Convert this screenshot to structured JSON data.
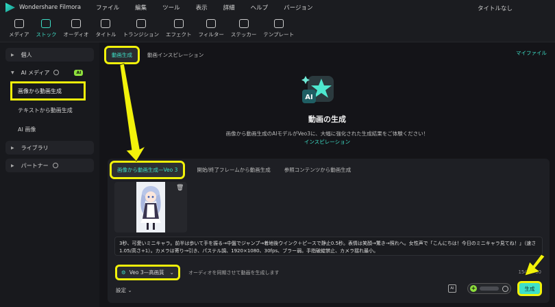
{
  "titlebar": {
    "app_name": "Wondershare Filmora",
    "menu": [
      "ファイル",
      "編集",
      "ツール",
      "表示",
      "詳細",
      "ヘルプ",
      "バージョン"
    ],
    "document_title": "タイトルなし"
  },
  "toolbar": {
    "items": [
      {
        "label": "メディア",
        "icon": "media-icon"
      },
      {
        "label": "ストック",
        "icon": "stock-icon"
      },
      {
        "label": "オーディオ",
        "icon": "audio-icon"
      },
      {
        "label": "タイトル",
        "icon": "title-icon"
      },
      {
        "label": "トランジション",
        "icon": "transition-icon"
      },
      {
        "label": "エフェクト",
        "icon": "effect-icon"
      },
      {
        "label": "フィルター",
        "icon": "filter-icon"
      },
      {
        "label": "ステッカー",
        "icon": "sticker-icon"
      },
      {
        "label": "テンプレート",
        "icon": "template-icon"
      }
    ],
    "active_index": 1
  },
  "sidebar": {
    "personal": "個人",
    "ai_media": "AI メディア",
    "ai_badge": "AI",
    "sub_items": [
      "画像から動画生成",
      "テキストから動画生成",
      "AI 画像"
    ],
    "library": "ライブラリ",
    "partner": "パートナー"
  },
  "main": {
    "tab_active": "動画生成",
    "tab_inspiration": "動画インスピレーション",
    "my_files": "マイファイル",
    "hero_title": "動画の生成",
    "hero_desc": "画像から動画生成のAIモデルがVeo3に、大幅に強化された生成結果をご体験ください！",
    "hero_link": "インスピレーション",
    "gen_tabs": [
      "画像から動画生成—Veo 3",
      "開始/終了フレームから動画生成",
      "参照コンテンツから動画生成"
    ],
    "prompt_text": "3秒、可愛いミニキャラ。前半は歩いて手を振る→中盤でジャンプ→着地後ウインク＋ピースで静止0.5秒。表情は笑顔→驚き→照れへ。女性声で「こんにちは！今日のミニキャラ見てね！」（速さ1.05/高さ+1）。カメラは寄り→引き、パステル調、1920×1080、30fps、ブラー弱。手指破綻禁止、カメラ揺れ最小。",
    "model": "Veo 3—高画質",
    "audio_note": "オーディオを同期させて動画を生成します",
    "counter": "154/1500",
    "settings": "設定",
    "ai_button": "AI",
    "generate": "生成"
  },
  "colors": {
    "accent": "#3ee0c8",
    "highlight": "#f2f20a",
    "badge": "#8ee03c"
  }
}
